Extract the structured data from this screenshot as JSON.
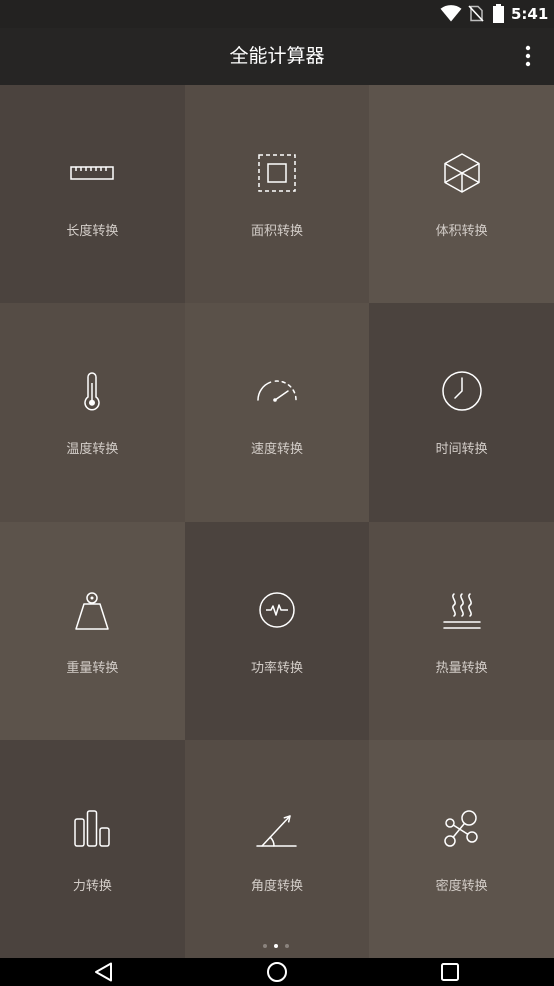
{
  "status_bar": {
    "time": "5:41",
    "icons": {
      "wifi": "wifi-icon",
      "sim": "no-sim-icon",
      "battery": "battery-icon"
    }
  },
  "app_bar": {
    "title": "全能计算器",
    "menu_icon": "overflow-menu-icon"
  },
  "colors": {
    "app_bar_bg": "#262524",
    "status_bar_bg": "#232221",
    "label_text": "#d3cdc8",
    "icon_stroke": "#ffffff"
  },
  "grid": {
    "cells": [
      {
        "label": "长度转换",
        "icon": "ruler-icon",
        "bg": "#4b433e"
      },
      {
        "label": "面积转换",
        "icon": "area-square-icon",
        "bg": "#554c45"
      },
      {
        "label": "体积转换",
        "icon": "cube-icon",
        "bg": "#5d544c"
      },
      {
        "label": "温度转换",
        "icon": "thermometer-icon",
        "bg": "#554c45"
      },
      {
        "label": "速度转换",
        "icon": "speedometer-icon",
        "bg": "#5a5149"
      },
      {
        "label": "时间转换",
        "icon": "clock-icon",
        "bg": "#4b433e"
      },
      {
        "label": "重量转换",
        "icon": "weight-icon",
        "bg": "#5c534b"
      },
      {
        "label": "功率转换",
        "icon": "power-pulse-icon",
        "bg": "#4b433e"
      },
      {
        "label": "热量转换",
        "icon": "heat-waves-icon",
        "bg": "#564d46"
      },
      {
        "label": "力转换",
        "icon": "bar-chart-icon",
        "bg": "#4b433e"
      },
      {
        "label": "角度转换",
        "icon": "angle-icon",
        "bg": "#554c45"
      },
      {
        "label": "密度转换",
        "icon": "molecule-icon",
        "bg": "#5d544c"
      }
    ]
  },
  "pager": {
    "pages": 3,
    "active_page": 2
  },
  "nav_bar": {
    "back": "back-icon",
    "home": "home-icon",
    "recents": "recents-icon"
  }
}
